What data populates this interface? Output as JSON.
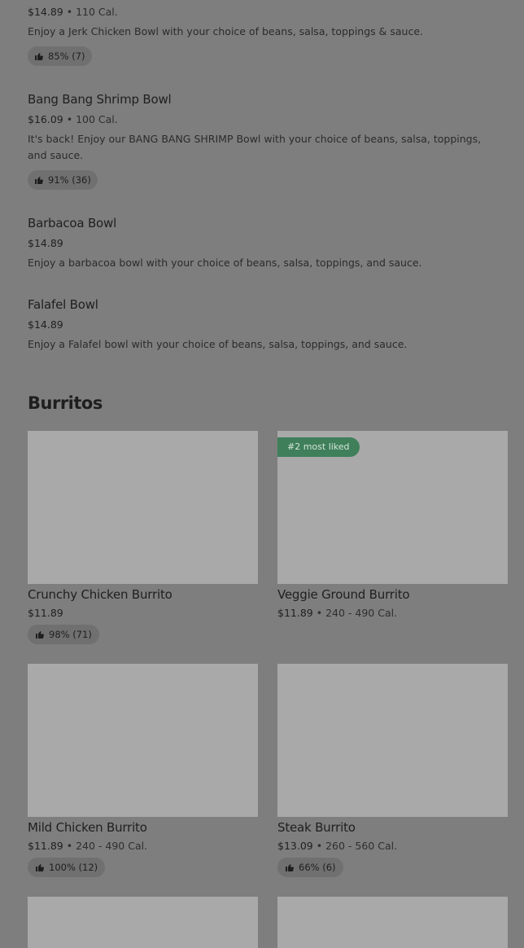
{
  "bowls": [
    {
      "price": "$14.89",
      "sep": " • ",
      "cal": "110 Cal.",
      "desc": "Enjoy a Jerk Chicken Bowl with your choice of beans, salsa, toppings & sauce.",
      "rating": "85% (7)"
    },
    {
      "name": "Bang Bang Shrimp Bowl",
      "price": "$16.09",
      "sep": " • ",
      "cal": "100 Cal.",
      "desc": "It's back! Enjoy our BANG BANG SHRIMP Bowl with your choice of beans, salsa, toppings, and sauce.",
      "rating": "91% (36)"
    },
    {
      "name": "Barbacoa Bowl",
      "price": "$14.89",
      "desc": "Enjoy a barbacoa bowl with your choice of beans, salsa, toppings, and sauce."
    },
    {
      "name": "Falafel Bowl",
      "price": "$14.89",
      "desc": "Enjoy a Falafel bowl with your choice of beans, salsa, toppings, and sauce."
    }
  ],
  "burritos": {
    "title": "Burritos",
    "items": [
      {
        "name": "Crunchy Chicken Burrito",
        "price": "$11.89",
        "rating": "98% (71)"
      },
      {
        "name": "Veggie Ground Burrito",
        "price": "$11.89",
        "sep": " • ",
        "cal": "240 - 490 Cal.",
        "badge": "#2 most liked"
      },
      {
        "name": "Mild Chicken Burrito",
        "price": "$11.89",
        "sep": " • ",
        "cal": "240 - 490 Cal.",
        "rating": "100% (12)"
      },
      {
        "name": "Steak Burrito",
        "price": "$13.09",
        "sep": " • ",
        "cal": "260 - 560 Cal.",
        "rating": "66% (6)"
      }
    ]
  },
  "icons": {
    "rating": "thumbs-up-icon"
  }
}
